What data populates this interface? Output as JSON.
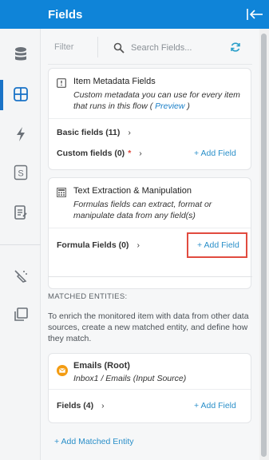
{
  "header": {
    "title": "Fields"
  },
  "rail": {
    "icons": [
      "database-icon",
      "layout-grid-icon",
      "lightning-icon",
      "s-box-icon",
      "notes-icon",
      "wand-icon",
      "copy-icon"
    ]
  },
  "filter": {
    "label": "Filter",
    "search_placeholder": "Search Fields..."
  },
  "item_metadata": {
    "title": "Item Metadata Fields",
    "desc_part1": "Custom metadata you can use for every item that runs in this flow ( ",
    "preview_link": "Preview",
    "desc_part2": " )",
    "basic_fields": "Basic fields (11)",
    "custom_fields": "Custom fields (0)",
    "required_mark": "*",
    "add_field": "+ Add Field"
  },
  "text_extraction": {
    "title": "Text Extraction & Manipulation",
    "desc": "Formulas fields can extract, format or manipulate data from any field(s)",
    "formula_fields": "Formula Fields (0)",
    "add_field": "+ Add Field"
  },
  "matched_entities": {
    "title": "MATCHED ENTITIES:",
    "desc": "To enrich the monitored item with data from other data sources, create a new matched entity, and define how they match.",
    "entity_title": "Emails (Root)",
    "entity_subtitle": "Inbox1 / Emails (Input Source)",
    "fields": "Fields (4)",
    "add_field": "+ Add Field",
    "add_matched_entity": "+ Add Matched Entity"
  },
  "colors": {
    "header_blue": "#0f84d8",
    "link_blue": "#2a8fc9",
    "highlight_red": "#e14b3f",
    "email_orange": "#f39c12"
  }
}
